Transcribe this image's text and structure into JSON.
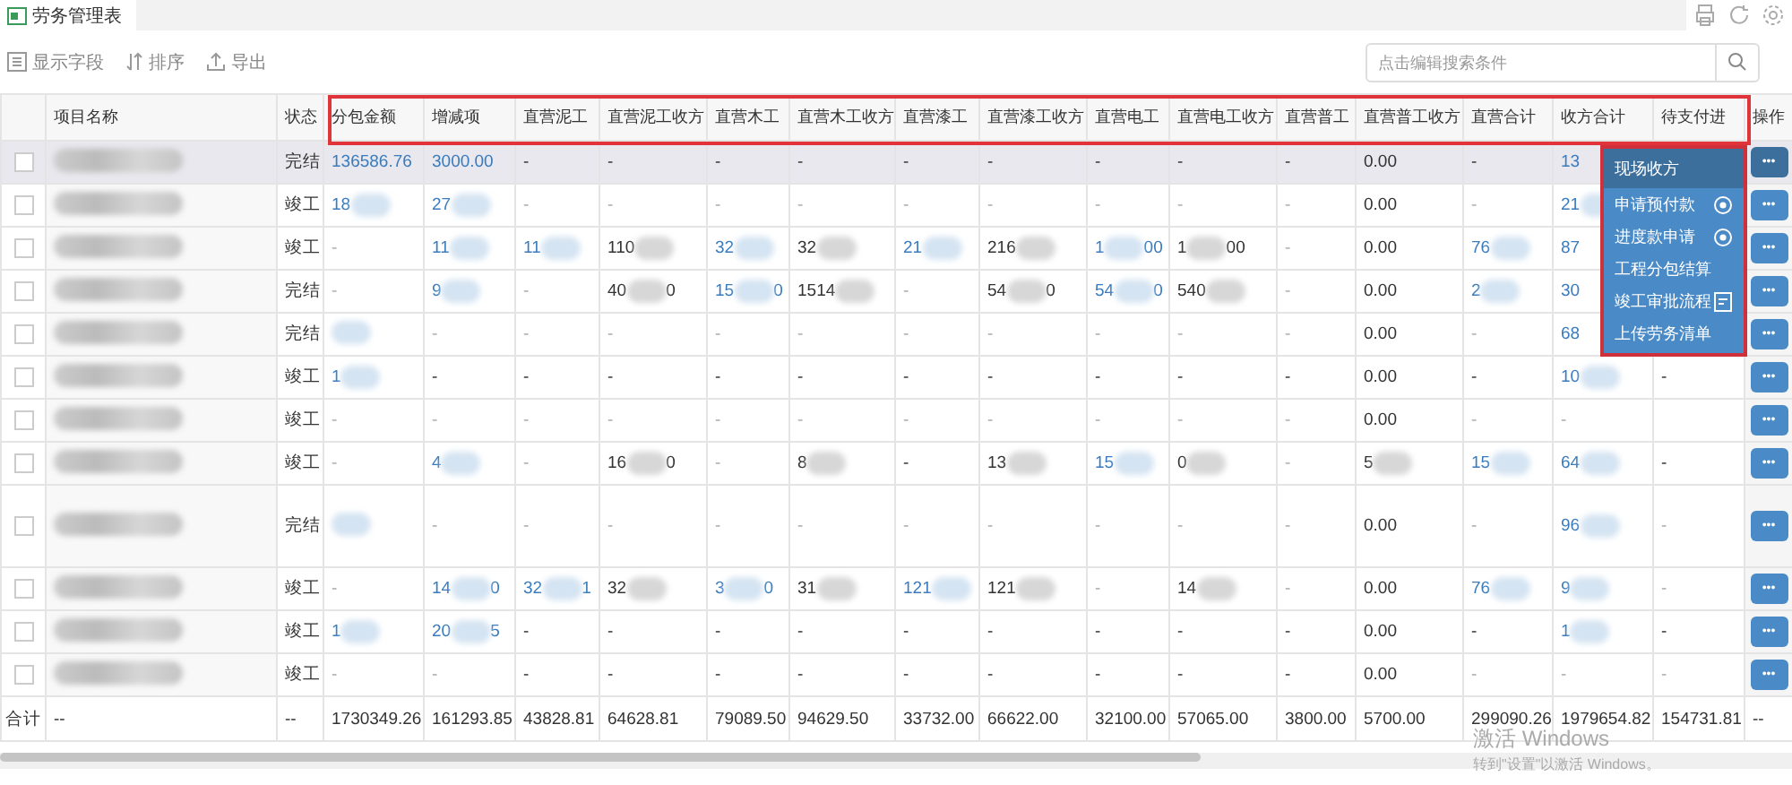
{
  "tab": {
    "label": "劳务管理表",
    "selected": true
  },
  "toolbar": [
    {
      "label": "显示字段"
    },
    {
      "label": "排序"
    },
    {
      "label": "导出"
    }
  ],
  "search": {
    "placeholder": "点击编辑搜索条件"
  },
  "table": {
    "outlined": true,
    "columns": [
      "项目名称",
      "状态",
      "分包金额",
      "增减项",
      "直营泥工",
      "直营泥工收方",
      "直营木工",
      "直营木工收方",
      "直营漆工",
      "直营漆工收方",
      "直营电工",
      "直营电工收方",
      "直营普工",
      "直营普工收方",
      "直营合计",
      "收方合计",
      "待支付进",
      "操作"
    ],
    "rows": [
      {
        "checked": false,
        "selected": true,
        "tall": false,
        "action": "•••",
        "cells": [
          {
            "kind": "plain",
            "blurred": true
          },
          {
            "text": "完结",
            "kind": "plain",
            "blurred": false
          },
          {
            "text": "136586.76",
            "kind": "link",
            "blurred": false
          },
          {
            "text": "3000.00",
            "kind": "link",
            "blurred": false
          },
          {
            "text": "-",
            "kind": "plain",
            "blurred": false
          },
          {
            "text": "-",
            "kind": "plain",
            "blurred": false
          },
          {
            "text": "-",
            "kind": "plain",
            "blurred": false
          },
          {
            "text": "-",
            "kind": "plain",
            "blurred": false
          },
          {
            "text": "-",
            "kind": "plain",
            "blurred": false
          },
          {
            "text": "-",
            "kind": "plain",
            "blurred": false
          },
          {
            "text": "-",
            "kind": "plain",
            "blurred": false
          },
          {
            "text": "-",
            "kind": "plain",
            "blurred": false
          },
          {
            "text": "-",
            "kind": "plain",
            "blurred": false
          },
          {
            "text": "0.00",
            "kind": "plain",
            "blurred": false
          },
          {
            "text": "-",
            "kind": "plain",
            "blurred": false
          },
          {
            "text": "13",
            "kind": "link",
            "blurred": false
          }
        ]
      },
      {
        "checked": false,
        "selected": false,
        "tall": false,
        "action": "•••",
        "cells": [
          {
            "kind": "plain",
            "blurred": true
          },
          {
            "text": "竣工",
            "kind": "plain",
            "blurred": false
          },
          {
            "text": "18",
            "kind": "link",
            "blurred": true
          },
          {
            "text": "27",
            "kind": "link",
            "blurred": true
          },
          {
            "text": "-",
            "kind": "muted",
            "blurred": false
          },
          {
            "text": "-",
            "kind": "muted",
            "blurred": false
          },
          {
            "text": "-",
            "kind": "muted",
            "blurred": false
          },
          {
            "text": "-",
            "kind": "muted",
            "blurred": false
          },
          {
            "text": "-",
            "kind": "muted",
            "blurred": false
          },
          {
            "text": "-",
            "kind": "muted",
            "blurred": false
          },
          {
            "text": "-",
            "kind": "muted",
            "blurred": false
          },
          {
            "text": "-",
            "kind": "muted",
            "blurred": false
          },
          {
            "text": "-",
            "kind": "muted",
            "blurred": false
          },
          {
            "text": "0.00",
            "kind": "plain",
            "blurred": false
          },
          {
            "text": "-",
            "kind": "muted",
            "blurred": false
          },
          {
            "text": "21",
            "kind": "link",
            "blurred": true
          }
        ]
      },
      {
        "checked": false,
        "selected": false,
        "tall": false,
        "action": "•••",
        "cells": [
          {
            "kind": "plain",
            "blurred": true
          },
          {
            "text": "竣工",
            "kind": "plain",
            "blurred": false
          },
          {
            "text": "-",
            "kind": "muted",
            "blurred": false
          },
          {
            "text": "11",
            "kind": "link",
            "blurred": true
          },
          {
            "text": "11",
            "kind": "link",
            "blurred": true
          },
          {
            "text": "110",
            "kind": "plain",
            "blurred": true
          },
          {
            "text": "32",
            "kind": "link",
            "blurred": true
          },
          {
            "text": "32",
            "kind": "plain",
            "blurred": true
          },
          {
            "text": "21",
            "kind": "link",
            "blurred": true
          },
          {
            "text": "216",
            "kind": "plain",
            "blurred": true
          },
          {
            "text": "1",
            "tail": "00",
            "kind": "link",
            "blurred": true
          },
          {
            "text": "1",
            "tail": "00",
            "kind": "plain",
            "blurred": true
          },
          {
            "text": "-",
            "kind": "muted",
            "blurred": false
          },
          {
            "text": "0.00",
            "kind": "plain",
            "blurred": false
          },
          {
            "text": "76",
            "kind": "link",
            "blurred": true
          },
          {
            "text": "87",
            "kind": "link",
            "blurred": false
          }
        ]
      },
      {
        "checked": false,
        "selected": false,
        "tall": false,
        "action": "•••",
        "cells": [
          {
            "kind": "plain",
            "blurred": true
          },
          {
            "text": "完结",
            "kind": "plain",
            "blurred": false
          },
          {
            "text": "-",
            "kind": "muted",
            "blurred": false
          },
          {
            "text": "9",
            "kind": "link",
            "blurred": true
          },
          {
            "text": "-",
            "kind": "muted",
            "blurred": false
          },
          {
            "text": "40",
            "tail": "0",
            "kind": "plain",
            "blurred": true
          },
          {
            "text": "15",
            "tail": "0",
            "kind": "link",
            "blurred": true
          },
          {
            "text": "1514",
            "kind": "plain",
            "blurred": true
          },
          {
            "text": "-",
            "kind": "muted",
            "blurred": false
          },
          {
            "text": "54",
            "tail": "0",
            "kind": "plain",
            "blurred": true
          },
          {
            "text": "54",
            "tail": "0",
            "kind": "link",
            "blurred": true
          },
          {
            "text": "540",
            "kind": "plain",
            "blurred": true
          },
          {
            "text": "-",
            "kind": "muted",
            "blurred": false
          },
          {
            "text": "0.00",
            "kind": "plain",
            "blurred": false
          },
          {
            "text": "2",
            "kind": "link",
            "blurred": true
          },
          {
            "text": "30",
            "kind": "link",
            "blurred": false
          }
        ]
      },
      {
        "checked": false,
        "selected": false,
        "tall": false,
        "action": "•••",
        "cells": [
          {
            "kind": "plain",
            "blurred": true
          },
          {
            "text": "完结",
            "kind": "plain",
            "blurred": false
          },
          {
            "kind": "link",
            "blurred": true
          },
          {
            "text": "-",
            "kind": "muted",
            "blurred": false
          },
          {
            "text": "-",
            "kind": "muted",
            "blurred": false
          },
          {
            "text": "-",
            "kind": "muted",
            "blurred": false
          },
          {
            "text": "-",
            "kind": "muted",
            "blurred": false
          },
          {
            "text": "-",
            "kind": "muted",
            "blurred": false
          },
          {
            "text": "-",
            "kind": "muted",
            "blurred": false
          },
          {
            "text": "-",
            "kind": "muted",
            "blurred": false
          },
          {
            "text": "-",
            "kind": "muted",
            "blurred": false
          },
          {
            "text": "-",
            "kind": "muted",
            "blurred": false
          },
          {
            "text": "-",
            "kind": "muted",
            "blurred": false
          },
          {
            "text": "0.00",
            "kind": "plain",
            "blurred": false
          },
          {
            "text": "-",
            "kind": "muted",
            "blurred": false
          },
          {
            "text": "68",
            "kind": "link",
            "blurred": false
          }
        ]
      },
      {
        "checked": false,
        "selected": false,
        "tall": false,
        "action": "•••",
        "cells": [
          {
            "kind": "plain",
            "blurred": true
          },
          {
            "text": "竣工",
            "kind": "plain",
            "blurred": false
          },
          {
            "text": "1",
            "kind": "link",
            "blurred": true
          },
          {
            "text": "-",
            "kind": "plain",
            "blurred": false
          },
          {
            "text": "-",
            "kind": "plain",
            "blurred": false
          },
          {
            "text": "-",
            "kind": "plain",
            "blurred": false
          },
          {
            "text": "-",
            "kind": "plain",
            "blurred": false
          },
          {
            "text": "-",
            "kind": "plain",
            "blurred": false
          },
          {
            "text": "-",
            "kind": "plain",
            "blurred": false
          },
          {
            "text": "-",
            "kind": "plain",
            "blurred": false
          },
          {
            "text": "-",
            "kind": "plain",
            "blurred": false
          },
          {
            "text": "-",
            "kind": "plain",
            "blurred": false
          },
          {
            "text": "-",
            "kind": "plain",
            "blurred": false
          },
          {
            "text": "0.00",
            "kind": "plain",
            "blurred": false
          },
          {
            "text": "-",
            "kind": "plain",
            "blurred": false
          },
          {
            "text": "10",
            "kind": "link",
            "blurred": true
          },
          {
            "text": "-",
            "kind": "plain",
            "blurred": false
          }
        ]
      },
      {
        "checked": false,
        "selected": false,
        "tall": false,
        "action": "•••",
        "cells": [
          {
            "kind": "plain",
            "blurred": true
          },
          {
            "text": "竣工",
            "kind": "plain",
            "blurred": false
          },
          {
            "text": "-",
            "kind": "muted",
            "blurred": false
          },
          {
            "text": "-",
            "kind": "muted",
            "blurred": false
          },
          {
            "text": "-",
            "kind": "muted",
            "blurred": false
          },
          {
            "text": "-",
            "kind": "muted",
            "blurred": false
          },
          {
            "text": "-",
            "kind": "muted",
            "blurred": false
          },
          {
            "text": "-",
            "kind": "muted",
            "blurred": false
          },
          {
            "text": "-",
            "kind": "muted",
            "blurred": false
          },
          {
            "text": "-",
            "kind": "muted",
            "blurred": false
          },
          {
            "text": "-",
            "kind": "muted",
            "blurred": false
          },
          {
            "text": "-",
            "kind": "muted",
            "blurred": false
          },
          {
            "text": "-",
            "kind": "muted",
            "blurred": false
          },
          {
            "text": "0.00",
            "kind": "plain",
            "blurred": false
          },
          {
            "text": "-",
            "kind": "muted",
            "blurred": false
          },
          {
            "text": "-",
            "kind": "muted",
            "blurred": false
          }
        ]
      },
      {
        "checked": false,
        "selected": false,
        "tall": false,
        "action": "•••",
        "cells": [
          {
            "kind": "plain",
            "blurred": true
          },
          {
            "text": "竣工",
            "kind": "plain",
            "blurred": false
          },
          {
            "text": "-",
            "kind": "muted",
            "blurred": false
          },
          {
            "text": "4",
            "kind": "link",
            "blurred": true
          },
          {
            "text": "-",
            "kind": "muted",
            "blurred": false
          },
          {
            "text": "16",
            "tail": "0",
            "kind": "plain",
            "blurred": true
          },
          {
            "text": "-",
            "kind": "muted",
            "blurred": false
          },
          {
            "text": "8",
            "kind": "plain",
            "blurred": true
          },
          {
            "text": "-",
            "kind": "plain",
            "blurred": false
          },
          {
            "text": "13",
            "kind": "plain",
            "blurred": true
          },
          {
            "text": "15",
            "kind": "link",
            "blurred": true
          },
          {
            "text": "0",
            "kind": "plain",
            "blurred": true
          },
          {
            "text": "-",
            "kind": "muted",
            "blurred": false
          },
          {
            "text": "5",
            "kind": "plain",
            "blurred": true
          },
          {
            "text": "15",
            "kind": "link",
            "blurred": true
          },
          {
            "text": "64",
            "kind": "link",
            "blurred": true
          },
          {
            "text": "-",
            "kind": "plain",
            "blurred": false
          }
        ]
      },
      {
        "checked": false,
        "selected": false,
        "tall": true,
        "action": "•••",
        "cells": [
          {
            "kind": "plain",
            "blurred": true
          },
          {
            "text": "完结",
            "kind": "plain",
            "blurred": false
          },
          {
            "kind": "link",
            "blurred": true
          },
          {
            "text": "-",
            "kind": "muted",
            "blurred": false
          },
          {
            "text": "-",
            "kind": "muted",
            "blurred": false
          },
          {
            "text": "-",
            "kind": "muted",
            "blurred": false
          },
          {
            "text": "-",
            "kind": "muted",
            "blurred": false
          },
          {
            "text": "-",
            "kind": "muted",
            "blurred": false
          },
          {
            "text": "-",
            "kind": "muted",
            "blurred": false
          },
          {
            "text": "-",
            "kind": "muted",
            "blurred": false
          },
          {
            "text": "-",
            "kind": "muted",
            "blurred": false
          },
          {
            "text": "-",
            "kind": "muted",
            "blurred": false
          },
          {
            "text": "-",
            "kind": "muted",
            "blurred": false
          },
          {
            "text": "0.00",
            "kind": "plain",
            "blurred": false
          },
          {
            "text": "-",
            "kind": "muted",
            "blurred": false
          },
          {
            "text": "96",
            "kind": "link",
            "blurred": true
          },
          {
            "text": "-",
            "kind": "muted",
            "blurred": false
          }
        ]
      },
      {
        "checked": false,
        "selected": false,
        "tall": false,
        "action": "•••",
        "cells": [
          {
            "kind": "plain",
            "blurred": true
          },
          {
            "text": "竣工",
            "kind": "plain",
            "blurred": false
          },
          {
            "text": "-",
            "kind": "muted",
            "blurred": false
          },
          {
            "text": "14",
            "tail": "0",
            "kind": "link",
            "blurred": true
          },
          {
            "text": "32",
            "tail": "1",
            "kind": "link",
            "blurred": true
          },
          {
            "text": "32",
            "kind": "plain",
            "blurred": true
          },
          {
            "text": "3",
            "tail": "0",
            "kind": "link",
            "blurred": true
          },
          {
            "text": "31",
            "kind": "plain",
            "blurred": true
          },
          {
            "text": "121",
            "kind": "link",
            "blurred": true
          },
          {
            "text": "121",
            "kind": "plain",
            "blurred": true
          },
          {
            "text": "-",
            "kind": "muted",
            "blurred": false
          },
          {
            "text": "14",
            "kind": "plain",
            "blurred": true
          },
          {
            "text": "-",
            "kind": "muted",
            "blurred": false
          },
          {
            "text": "0.00",
            "kind": "plain",
            "blurred": false
          },
          {
            "text": "76",
            "kind": "link",
            "blurred": true
          },
          {
            "text": "9",
            "kind": "link",
            "blurred": true
          },
          {
            "text": "-",
            "kind": "muted",
            "blurred": false
          }
        ]
      },
      {
        "checked": false,
        "selected": false,
        "tall": false,
        "action": "•••",
        "cells": [
          {
            "kind": "plain",
            "blurred": true
          },
          {
            "text": "竣工",
            "kind": "plain",
            "blurred": false
          },
          {
            "text": "1",
            "kind": "link",
            "blurred": true
          },
          {
            "text": "20",
            "tail": "5",
            "kind": "link",
            "blurred": true
          },
          {
            "text": "-",
            "kind": "plain",
            "blurred": false
          },
          {
            "text": "-",
            "kind": "plain",
            "blurred": false
          },
          {
            "text": "-",
            "kind": "plain",
            "blurred": false
          },
          {
            "text": "-",
            "kind": "plain",
            "blurred": false
          },
          {
            "text": "-",
            "kind": "plain",
            "blurred": false
          },
          {
            "text": "-",
            "kind": "plain",
            "blurred": false
          },
          {
            "text": "-",
            "kind": "plain",
            "blurred": false
          },
          {
            "text": "-",
            "kind": "plain",
            "blurred": false
          },
          {
            "text": "-",
            "kind": "plain",
            "blurred": false
          },
          {
            "text": "0.00",
            "kind": "plain",
            "blurred": false
          },
          {
            "text": "-",
            "kind": "plain",
            "blurred": false
          },
          {
            "text": "1",
            "kind": "link",
            "blurred": true
          },
          {
            "text": "-",
            "kind": "plain",
            "blurred": false
          }
        ]
      },
      {
        "checked": false,
        "selected": false,
        "tall": false,
        "action": "•••",
        "cells": [
          {
            "kind": "plain",
            "blurred": true
          },
          {
            "text": "竣工",
            "kind": "plain",
            "blurred": false
          },
          {
            "text": "-",
            "kind": "muted",
            "blurred": false
          },
          {
            "text": "-",
            "kind": "muted",
            "blurred": false
          },
          {
            "text": "-",
            "kind": "plain",
            "blurred": false
          },
          {
            "text": "-",
            "kind": "plain",
            "blurred": false
          },
          {
            "text": "-",
            "kind": "plain",
            "blurred": false
          },
          {
            "text": "-",
            "kind": "plain",
            "blurred": false
          },
          {
            "text": "-",
            "kind": "plain",
            "blurred": false
          },
          {
            "text": "-",
            "kind": "plain",
            "blurred": false
          },
          {
            "text": "-",
            "kind": "plain",
            "blurred": false
          },
          {
            "text": "-",
            "kind": "plain",
            "blurred": false
          },
          {
            "text": "-",
            "kind": "plain",
            "blurred": false
          },
          {
            "text": "0.00",
            "kind": "plain",
            "blurred": false
          },
          {
            "text": "-",
            "kind": "muted",
            "blurred": false
          },
          {
            "text": "-",
            "kind": "muted",
            "blurred": false
          },
          {
            "text": "-",
            "kind": "muted",
            "blurred": false
          }
        ]
      }
    ],
    "totals": [
      "合计",
      "--",
      "--",
      "1730349.26",
      "161293.85",
      "43828.81",
      "64628.81",
      "79089.50",
      "94629.50",
      "33732.00",
      "66622.00",
      "32100.00",
      "57065.00",
      "3800.00",
      "5700.00",
      "299090.26",
      "1979654.82",
      "154731.81",
      "--"
    ]
  },
  "menu": {
    "outlined": true,
    "items": [
      {
        "label": "现场收方",
        "selected": true
      },
      {
        "label": "申请预付款",
        "selected": false
      },
      {
        "label": "进度款申请",
        "selected": false
      },
      {
        "label": "工程分包结算",
        "selected": false
      },
      {
        "label": "竣工审批流程",
        "selected": false
      },
      {
        "label": "上传劳务清单",
        "selected": false
      }
    ]
  },
  "os_notice": {
    "title": "激活 Windows",
    "text": "转到\"设置\"以激活 Windows。"
  }
}
